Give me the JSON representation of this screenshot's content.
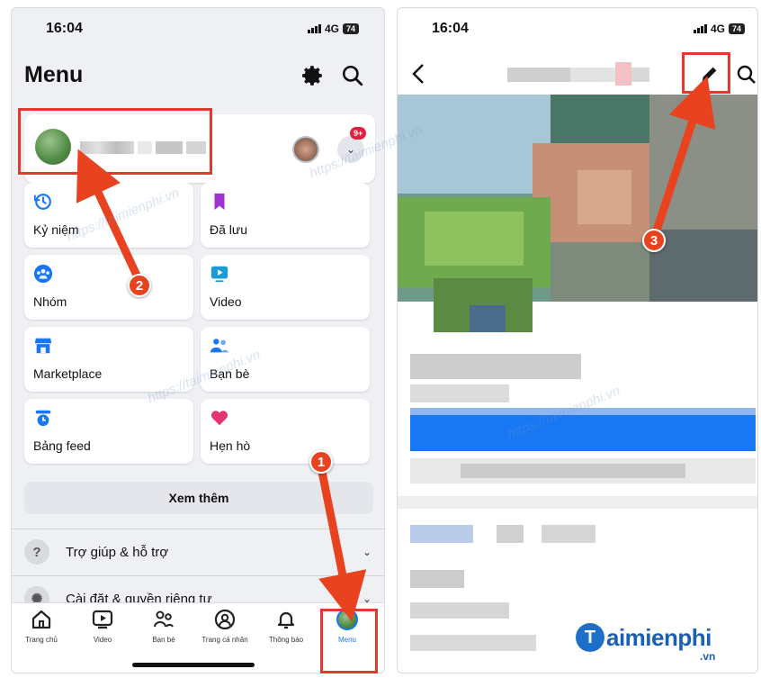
{
  "left": {
    "status": {
      "time": "16:04",
      "network": "4G",
      "battery": "74"
    },
    "header": {
      "title": "Menu"
    },
    "profile": {
      "notification_count": "9+"
    },
    "tiles": [
      {
        "label": "Kỷ niệm",
        "icon": "history-clock-icon",
        "color": "#1877f2"
      },
      {
        "label": "Đã lưu",
        "icon": "bookmark-icon",
        "color": "#a033cf"
      },
      {
        "label": "Nhóm",
        "icon": "groups-icon",
        "color": "#1877f2"
      },
      {
        "label": "Video",
        "icon": "video-play-icon",
        "color": "#1b9ad6"
      },
      {
        "label": "Marketplace",
        "icon": "storefront-icon",
        "color": "#1877f2"
      },
      {
        "label": "Bạn bè",
        "icon": "friends-icon",
        "color": "#1877f2"
      },
      {
        "label": "Bảng feed",
        "icon": "feed-clock-icon",
        "color": "#1877f2"
      },
      {
        "label": "Hẹn hò",
        "icon": "heart-icon",
        "color": "#e5336f"
      }
    ],
    "see_more": "Xem thêm",
    "rows": [
      {
        "label": "Trợ giúp & hỗ trợ",
        "icon": "help-icon"
      },
      {
        "label": "Cài đặt & quyền riêng tư",
        "icon": "settings-icon"
      }
    ],
    "tabbar": [
      {
        "label": "Trang chủ",
        "icon": "home-icon"
      },
      {
        "label": "Video",
        "icon": "video-icon"
      },
      {
        "label": "Bạn bè",
        "icon": "friends-icon"
      },
      {
        "label": "Trang cá nhân",
        "icon": "profile-icon"
      },
      {
        "label": "Thông báo",
        "icon": "bell-icon"
      },
      {
        "label": "Menu",
        "icon": "menu-avatar-icon",
        "active": true
      }
    ]
  },
  "right": {
    "status": {
      "time": "16:04",
      "network": "4G",
      "battery": "74"
    }
  },
  "annotations": {
    "step1": "1",
    "step2": "2",
    "step3": "3"
  },
  "watermark": "https://taimienphi.vn",
  "logo": {
    "text": "aimienphi",
    "initial": "T",
    "suffix": ".vn"
  },
  "colors": {
    "accent": "#1877f2",
    "annotation_red": "#e23a2e",
    "badge_red": "#e41e3f"
  }
}
